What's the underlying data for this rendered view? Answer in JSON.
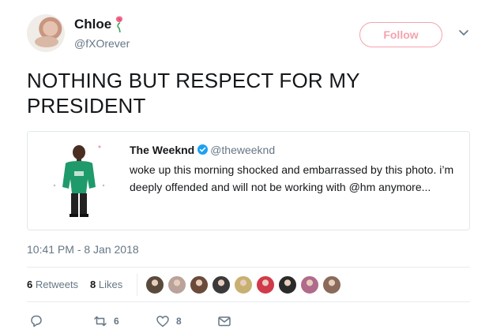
{
  "author": {
    "name": "Chloe",
    "handle": "@fXOrever",
    "accent_color": "#f4a3ad"
  },
  "follow_label": "Follow",
  "tweet": {
    "text": "NOTHING BUT RESPECT FOR MY PRESIDENT"
  },
  "quoted": {
    "name": "The Weeknd",
    "handle": "@theweeknd",
    "verified": true,
    "text": "woke up this morning shocked and embarrassed by this photo. i’m deeply offended and will not be working with @hm anymore...",
    "image": "child-in-green-hoodie-photo"
  },
  "timestamp": "10:41 PM - 8 Jan 2018",
  "stats": {
    "retweets_count": "6",
    "retweets_label": "Retweets",
    "likes_count": "8",
    "likes_label": "Likes",
    "liker_avatars": [
      "#5a4a3c",
      "#b9a39a",
      "#6b4a3a",
      "#3a3a3a",
      "#c8b070",
      "#d03a4a",
      "#2a2a2a",
      "#b06a8a",
      "#8a6a5a"
    ]
  },
  "actions": {
    "reply_icon": "reply-icon",
    "retweet_icon": "retweet-icon",
    "retweet_count": "6",
    "like_icon": "heart-icon",
    "like_count": "8",
    "dm_icon": "envelope-icon"
  }
}
